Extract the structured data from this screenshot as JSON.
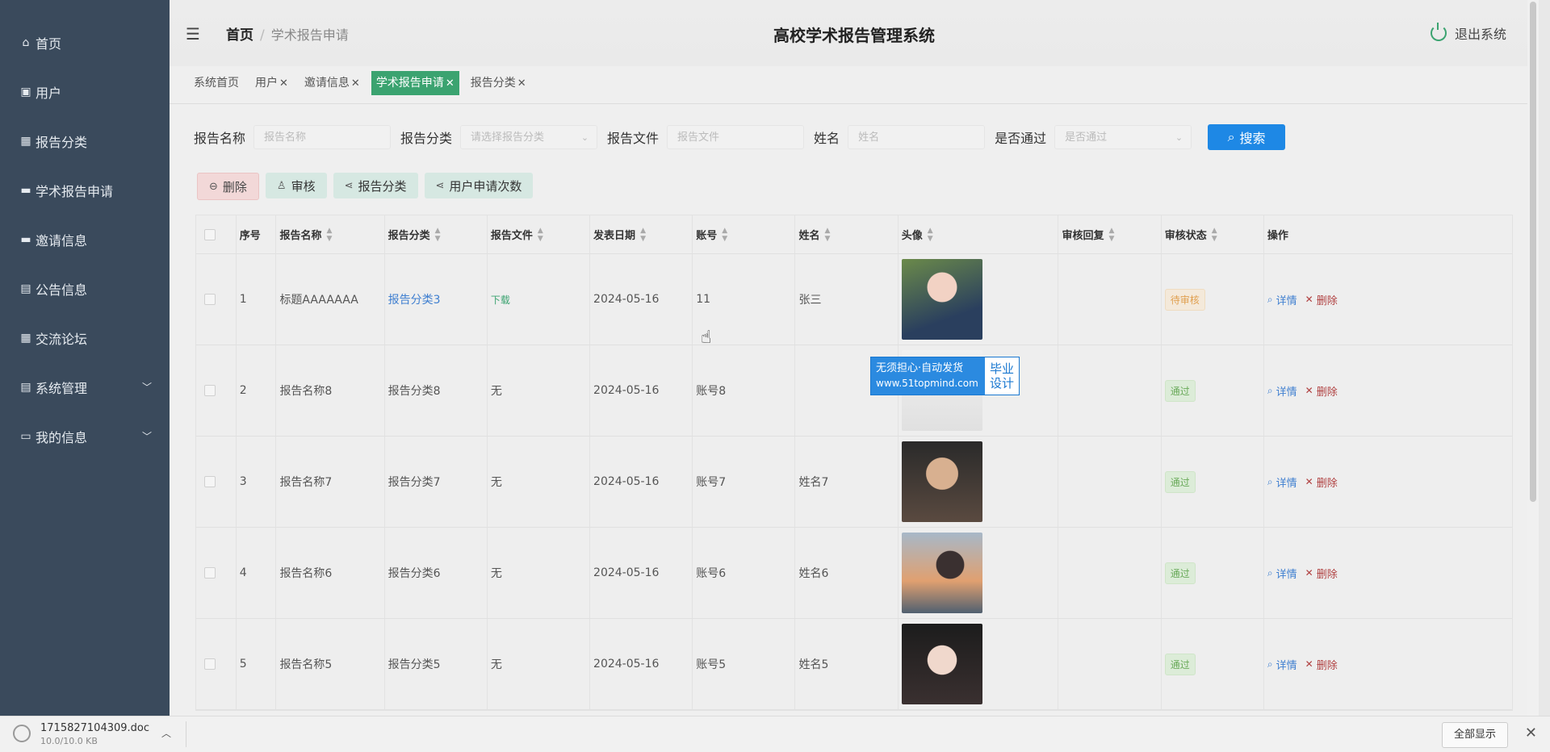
{
  "sidebar": {
    "items": [
      {
        "label": "首页",
        "icon": "home-icon",
        "glyph": "⌂"
      },
      {
        "label": "用户",
        "icon": "chart-icon",
        "glyph": "▣"
      },
      {
        "label": "报告分类",
        "icon": "grid-icon",
        "glyph": "▦"
      },
      {
        "label": "学术报告申请",
        "icon": "briefcase-icon",
        "glyph": "▬"
      },
      {
        "label": "邀请信息",
        "icon": "briefcase-icon",
        "glyph": "▬"
      },
      {
        "label": "公告信息",
        "icon": "clipboard-icon",
        "glyph": "▤"
      },
      {
        "label": "交流论坛",
        "icon": "grid-icon",
        "glyph": "▦"
      },
      {
        "label": "系统管理",
        "icon": "clipboard-icon",
        "glyph": "▤",
        "expand": true
      },
      {
        "label": "我的信息",
        "icon": "card-icon",
        "glyph": "▭",
        "expand": true
      }
    ]
  },
  "header": {
    "breadcrumb_home": "首页",
    "breadcrumb_sep": "/",
    "breadcrumb_current": "学术报告申请",
    "title": "高校学术报告管理系统",
    "logout": "退出系统"
  },
  "tabs": [
    {
      "label": "系统首页",
      "closable": false,
      "active": false
    },
    {
      "label": "用户",
      "closable": true,
      "active": false
    },
    {
      "label": "邀请信息",
      "closable": true,
      "active": false
    },
    {
      "label": "学术报告申请",
      "closable": true,
      "active": true
    },
    {
      "label": "报告分类",
      "closable": true,
      "active": false
    }
  ],
  "search": {
    "name_label": "报告名称",
    "name_placeholder": "报告名称",
    "category_label": "报告分类",
    "category_placeholder": "请选择报告分类",
    "file_label": "报告文件",
    "file_placeholder": "报告文件",
    "person_label": "姓名",
    "person_placeholder": "姓名",
    "pass_label": "是否通过",
    "pass_placeholder": "是否通过",
    "button": "搜索"
  },
  "actions": {
    "delete": "删除",
    "review": "审核",
    "category": "报告分类",
    "count": "用户申请次数"
  },
  "table": {
    "headers": [
      "序号",
      "报告名称",
      "报告分类",
      "报告文件",
      "发表日期",
      "账号",
      "姓名",
      "头像",
      "审核回复",
      "审核状态",
      "操作"
    ],
    "detail": "详情",
    "delete": "删除",
    "rows": [
      {
        "no": "1",
        "name": "标题AAAAAAA",
        "category": "报告分类3",
        "file": "下载",
        "date": "2024-05-16",
        "account": "11",
        "person": "张三",
        "reply": "",
        "status": "待审核",
        "status_type": "pending"
      },
      {
        "no": "2",
        "name": "报告名称8",
        "category": "报告分类8",
        "file": "无",
        "date": "2024-05-16",
        "account": "账号8",
        "person": "",
        "reply": "",
        "status": "通过",
        "status_type": "pass"
      },
      {
        "no": "3",
        "name": "报告名称7",
        "category": "报告分类7",
        "file": "无",
        "date": "2024-05-16",
        "account": "账号7",
        "person": "姓名7",
        "reply": "",
        "status": "通过",
        "status_type": "pass"
      },
      {
        "no": "4",
        "name": "报告名称6",
        "category": "报告分类6",
        "file": "无",
        "date": "2024-05-16",
        "account": "账号6",
        "person": "姓名6",
        "reply": "",
        "status": "通过",
        "status_type": "pass"
      },
      {
        "no": "5",
        "name": "报告名称5",
        "category": "报告分类5",
        "file": "无",
        "date": "2024-05-16",
        "account": "账号5",
        "person": "姓名5",
        "reply": "",
        "status": "通过",
        "status_type": "pass"
      }
    ]
  },
  "watermark": {
    "line1": "无须担心·自动发货",
    "line2": "www.51topmind.com",
    "r1": "毕业",
    "r2": "设计"
  },
  "download_bar": {
    "filename": "1715827104309.doc",
    "size": "10.0/10.0 KB",
    "show_all": "全部显示"
  },
  "colors": {
    "sidebar": "#3a4a5c",
    "accent": "#3ba370",
    "primary": "#1e88e5"
  }
}
